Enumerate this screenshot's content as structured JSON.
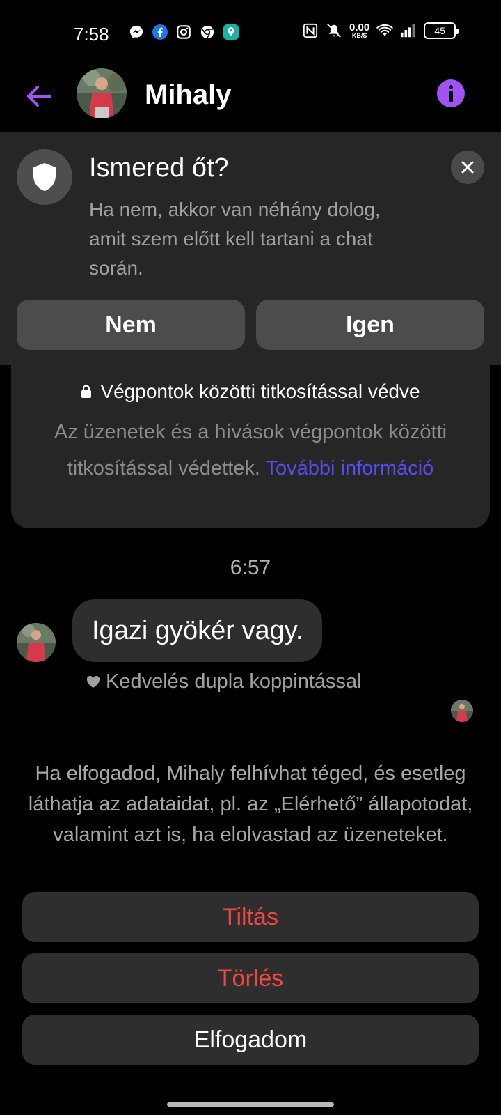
{
  "status_bar": {
    "time": "7:58",
    "app_icons": [
      "messenger-icon",
      "facebook-icon",
      "instagram-icon",
      "chrome-icon",
      "maps-icon"
    ],
    "net_speed_value": "0.00",
    "net_speed_unit": "KB/S",
    "battery": "45"
  },
  "header": {
    "name": "Mihaly"
  },
  "safety_card": {
    "title": "Ismered őt?",
    "text": "Ha nem, akkor van néhány dolog, amit szem előtt kell tartani a chat során.",
    "no_label": "Nem",
    "yes_label": "Igen"
  },
  "encryption": {
    "title": "Végpontok közötti titkosítással védve",
    "text": "Az üzenetek és a hívások végpontok közötti titkosítással védettek.",
    "link": "További információ"
  },
  "conversation": {
    "timestamp": "6:57",
    "message": "Igazi gyökér vagy.",
    "like_hint": "Kedvelés dupla koppintással"
  },
  "request": {
    "notice": "Ha elfogadod, Mihaly felhívhat téged, és esetleg láthatja az adataidat, pl. az „Elérhető” állapotodat, valamint azt is, ha elolvastad az üzeneteket.",
    "block_label": "Tiltás",
    "delete_label": "Törlés",
    "accept_label": "Elfogadom"
  },
  "colors": {
    "accent": "#a052f4",
    "link": "#5a4bf0",
    "danger": "#f0473e",
    "card": "#262626"
  }
}
